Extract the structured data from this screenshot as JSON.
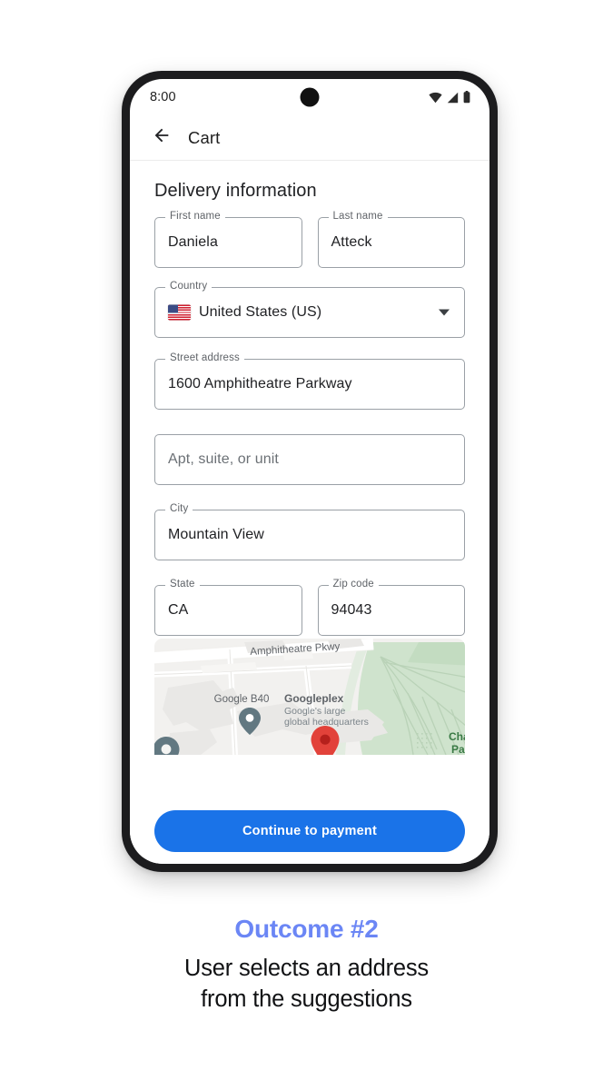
{
  "phone": {
    "status_bar": {
      "time": "8:00",
      "icons": [
        "wifi-icon",
        "signal-icon",
        "battery-icon"
      ]
    },
    "app_bar": {
      "back_icon": "arrow-back-icon",
      "title": "Cart"
    },
    "section_title": "Delivery information",
    "fields": [
      {
        "name": "first-name",
        "label": "First name",
        "value": "Daniela",
        "placeholder": ""
      },
      {
        "name": "last-name",
        "label": "Last name",
        "value": "Atteck",
        "placeholder": ""
      },
      {
        "name": "country",
        "label": "Country",
        "value": "United States (US)",
        "placeholder": ""
      },
      {
        "name": "street-address",
        "label": "Street address",
        "value": "1600 Amphitheatre Parkway",
        "placeholder": ""
      },
      {
        "name": "apt-suite-unit",
        "label": "",
        "value": "",
        "placeholder": "Apt, suite, or unit"
      },
      {
        "name": "city",
        "label": "City",
        "value": "Mountain View",
        "placeholder": ""
      },
      {
        "name": "state",
        "label": "State",
        "value": "CA",
        "placeholder": ""
      },
      {
        "name": "zip-code",
        "label": "Zip code",
        "value": "94043",
        "placeholder": ""
      }
    ],
    "map": {
      "labels": {
        "road": "Amphitheatre Pkwy",
        "poi_b40": "Google B40",
        "poi_plex_title": "Googleplex",
        "poi_plex_sub_line1": "Google's large",
        "poi_plex_sub_line2": "global headquarters",
        "park_line1": "Charle",
        "park_line2": "Par"
      },
      "colors": {
        "land": "#f2f1ef",
        "road": "#ffffff",
        "building": "#e9e8e6",
        "park": "#cfe3cd",
        "marker": "#e2423a",
        "poi_pin": "#627881"
      }
    },
    "bottom_bar": {
      "cta_label": "Continue to payment",
      "cta_color": "#1a73e8"
    }
  },
  "caption": {
    "outcome": "Outcome #2",
    "line1": "User selects an address",
    "line2": "from the suggestions",
    "outcome_color": "#6b86f5"
  }
}
